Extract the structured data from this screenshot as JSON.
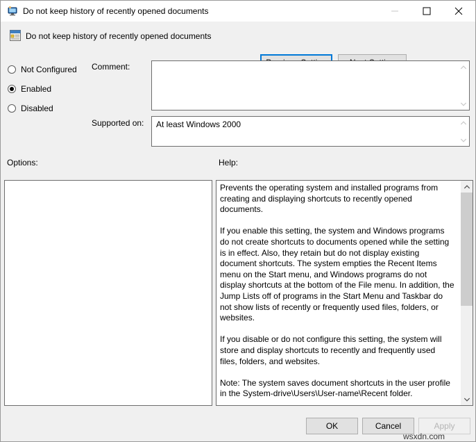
{
  "window": {
    "title": "Do not keep history of recently opened documents",
    "title_icon": "computer-monitor-icon",
    "controls": {
      "minimize": "minimize-icon",
      "maximize": "maximize-icon",
      "close": "close-icon"
    }
  },
  "header": {
    "icon": "policy-setting-icon",
    "title": "Do not keep history of recently opened documents",
    "previous_setting_label": "Previous Setting",
    "next_setting_label": "Next Setting"
  },
  "state_options": {
    "items": [
      {
        "label": "Not Configured",
        "selected": false
      },
      {
        "label": "Enabled",
        "selected": true
      },
      {
        "label": "Disabled",
        "selected": false
      }
    ]
  },
  "comment": {
    "label": "Comment:",
    "value": "",
    "placeholder": ""
  },
  "supported_on": {
    "label": "Supported on:",
    "value": "At least Windows 2000"
  },
  "options": {
    "label": "Options:",
    "value": ""
  },
  "help": {
    "label": "Help:",
    "text": "Prevents the operating system and installed programs from creating and displaying shortcuts to recently opened documents.\n\nIf you enable this setting, the system and Windows programs do not create shortcuts to documents opened while the setting is in effect. Also, they retain but do not display existing document shortcuts. The system empties the Recent Items menu on the Start menu, and Windows programs do not display shortcuts at the bottom of the File menu. In addition, the Jump Lists off of programs in the Start Menu and Taskbar do not show lists of recently or frequently used files, folders, or websites.\n\nIf you disable or do not configure this setting, the system will store and display shortcuts to recently and frequently used files, folders, and websites.\n\nNote: The system saves document shortcuts in the user profile in the System-drive\\Users\\User-name\\Recent folder.\n\nAlso, see the \"Remove Recent Items menu from Start Menu\" and \"Clear history of recently opened documents on exit\" policies in"
  },
  "footer": {
    "ok_label": "OK",
    "cancel_label": "Cancel",
    "apply_label": "Apply",
    "apply_enabled": false
  },
  "watermark": {
    "text": "wsxdn.com"
  },
  "colors": {
    "dialog_background": "#f0f0f0",
    "field_background": "#ffffff",
    "focus_border": "#0078d7",
    "button_face": "#e1e1e1",
    "border": "#6d6d6d",
    "scrollbar_thumb": "#cdcdcd",
    "disabled_text": "#b5b5b5"
  }
}
